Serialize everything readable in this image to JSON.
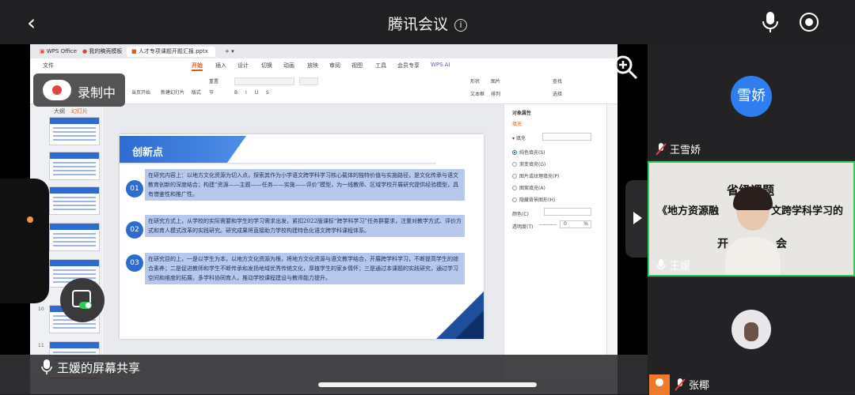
{
  "header": {
    "title": "腾讯会议"
  },
  "recording": {
    "label": "录制中"
  },
  "sharer": {
    "label": "王媛的屏幕共享"
  },
  "wps": {
    "tabs": [
      "WPS Office",
      "我的稿壳模板",
      "人才专项课题开题汇报.pptx"
    ],
    "ribbon_tabs": [
      "文件",
      "开始",
      "插入",
      "设计",
      "切换",
      "动画",
      "放映",
      "审阅",
      "视图",
      "工具",
      "会员专享",
      "WPS AI"
    ],
    "ribbon": {
      "play_from_current": "当页开始",
      "new_slide": "新建幻灯片",
      "layout": "版式",
      "section": "节",
      "reset": "重置",
      "shape": "形状",
      "picture": "图片",
      "textbox": "文本框",
      "arrange": "排列",
      "find": "查找",
      "select": "选择"
    },
    "thumb_tabs": [
      "大纲",
      "幻灯片"
    ],
    "slide_numbers": [
      "9",
      "10",
      "11",
      "12"
    ],
    "properties": {
      "title": "对象属性",
      "tab": "填充",
      "section": "填充",
      "options": [
        "纯色填充(S)",
        "渐变填充(G)",
        "图片或纹理填充(P)",
        "图案填充(A)",
        "隐藏背景图形(H)"
      ],
      "color_label": "颜色(C)",
      "transparency_label": "透明度(T)",
      "transparency_value": "0",
      "transparency_unit": "%"
    }
  },
  "slide": {
    "title": "创新点",
    "items": [
      {
        "num": "01",
        "text": "在研究内容上：以地方文化资源为切入点，探索其作为小学语文跨学科学习核心载体的独特价值与实施路径，是文化传承与语文教育创新的深度结合；构建“资源——主题——任务——实施——评价”模型，为一线教师、区域学校开展研究提供经验模型，具有借鉴性和推广性。"
      },
      {
        "num": "02",
        "text": "在研究方式上，从学校的实际需要和学生的学习需求出发，紧扣2022版课标“跨学科学习”任务群要求，注重对教学方式、评价方式和育人模式改革的实践研究。研究成果将直接助力学校构建特色化语文跨学科课程体系。"
      },
      {
        "num": "03",
        "text": "在研究目的上，一是以学生为本，以地方文化资源为根，将地方文化资源与语文教学结合，开展跨学科学习，不断提高学生的综合素养；二是促进教师和学生不断传承和发扬地域优秀传统文化，厚植学生的家乡情怀；三是通过本课题的实践研究，通过学习空间和维度的拓展，多学科协同育人，推动学校课程建设与教师能力提升。"
      }
    ]
  },
  "participants": [
    {
      "avatar_text": "雪娇",
      "name": "王雪娇",
      "muted": true
    },
    {
      "name": "王媛",
      "muted": false,
      "shared_view": {
        "line1": "省级课题",
        "line2": "《地方资源融",
        "line2b": "文跨学科学习的",
        "line3a": "开",
        "line3b": "会"
      }
    },
    {
      "name": "张椰",
      "muted": true
    }
  ],
  "colors": {
    "accent_blue": "#2e6bd1",
    "wps_orange": "#e05b1b",
    "active_speaker": "#34c759",
    "muted_red": "#e0463c"
  }
}
